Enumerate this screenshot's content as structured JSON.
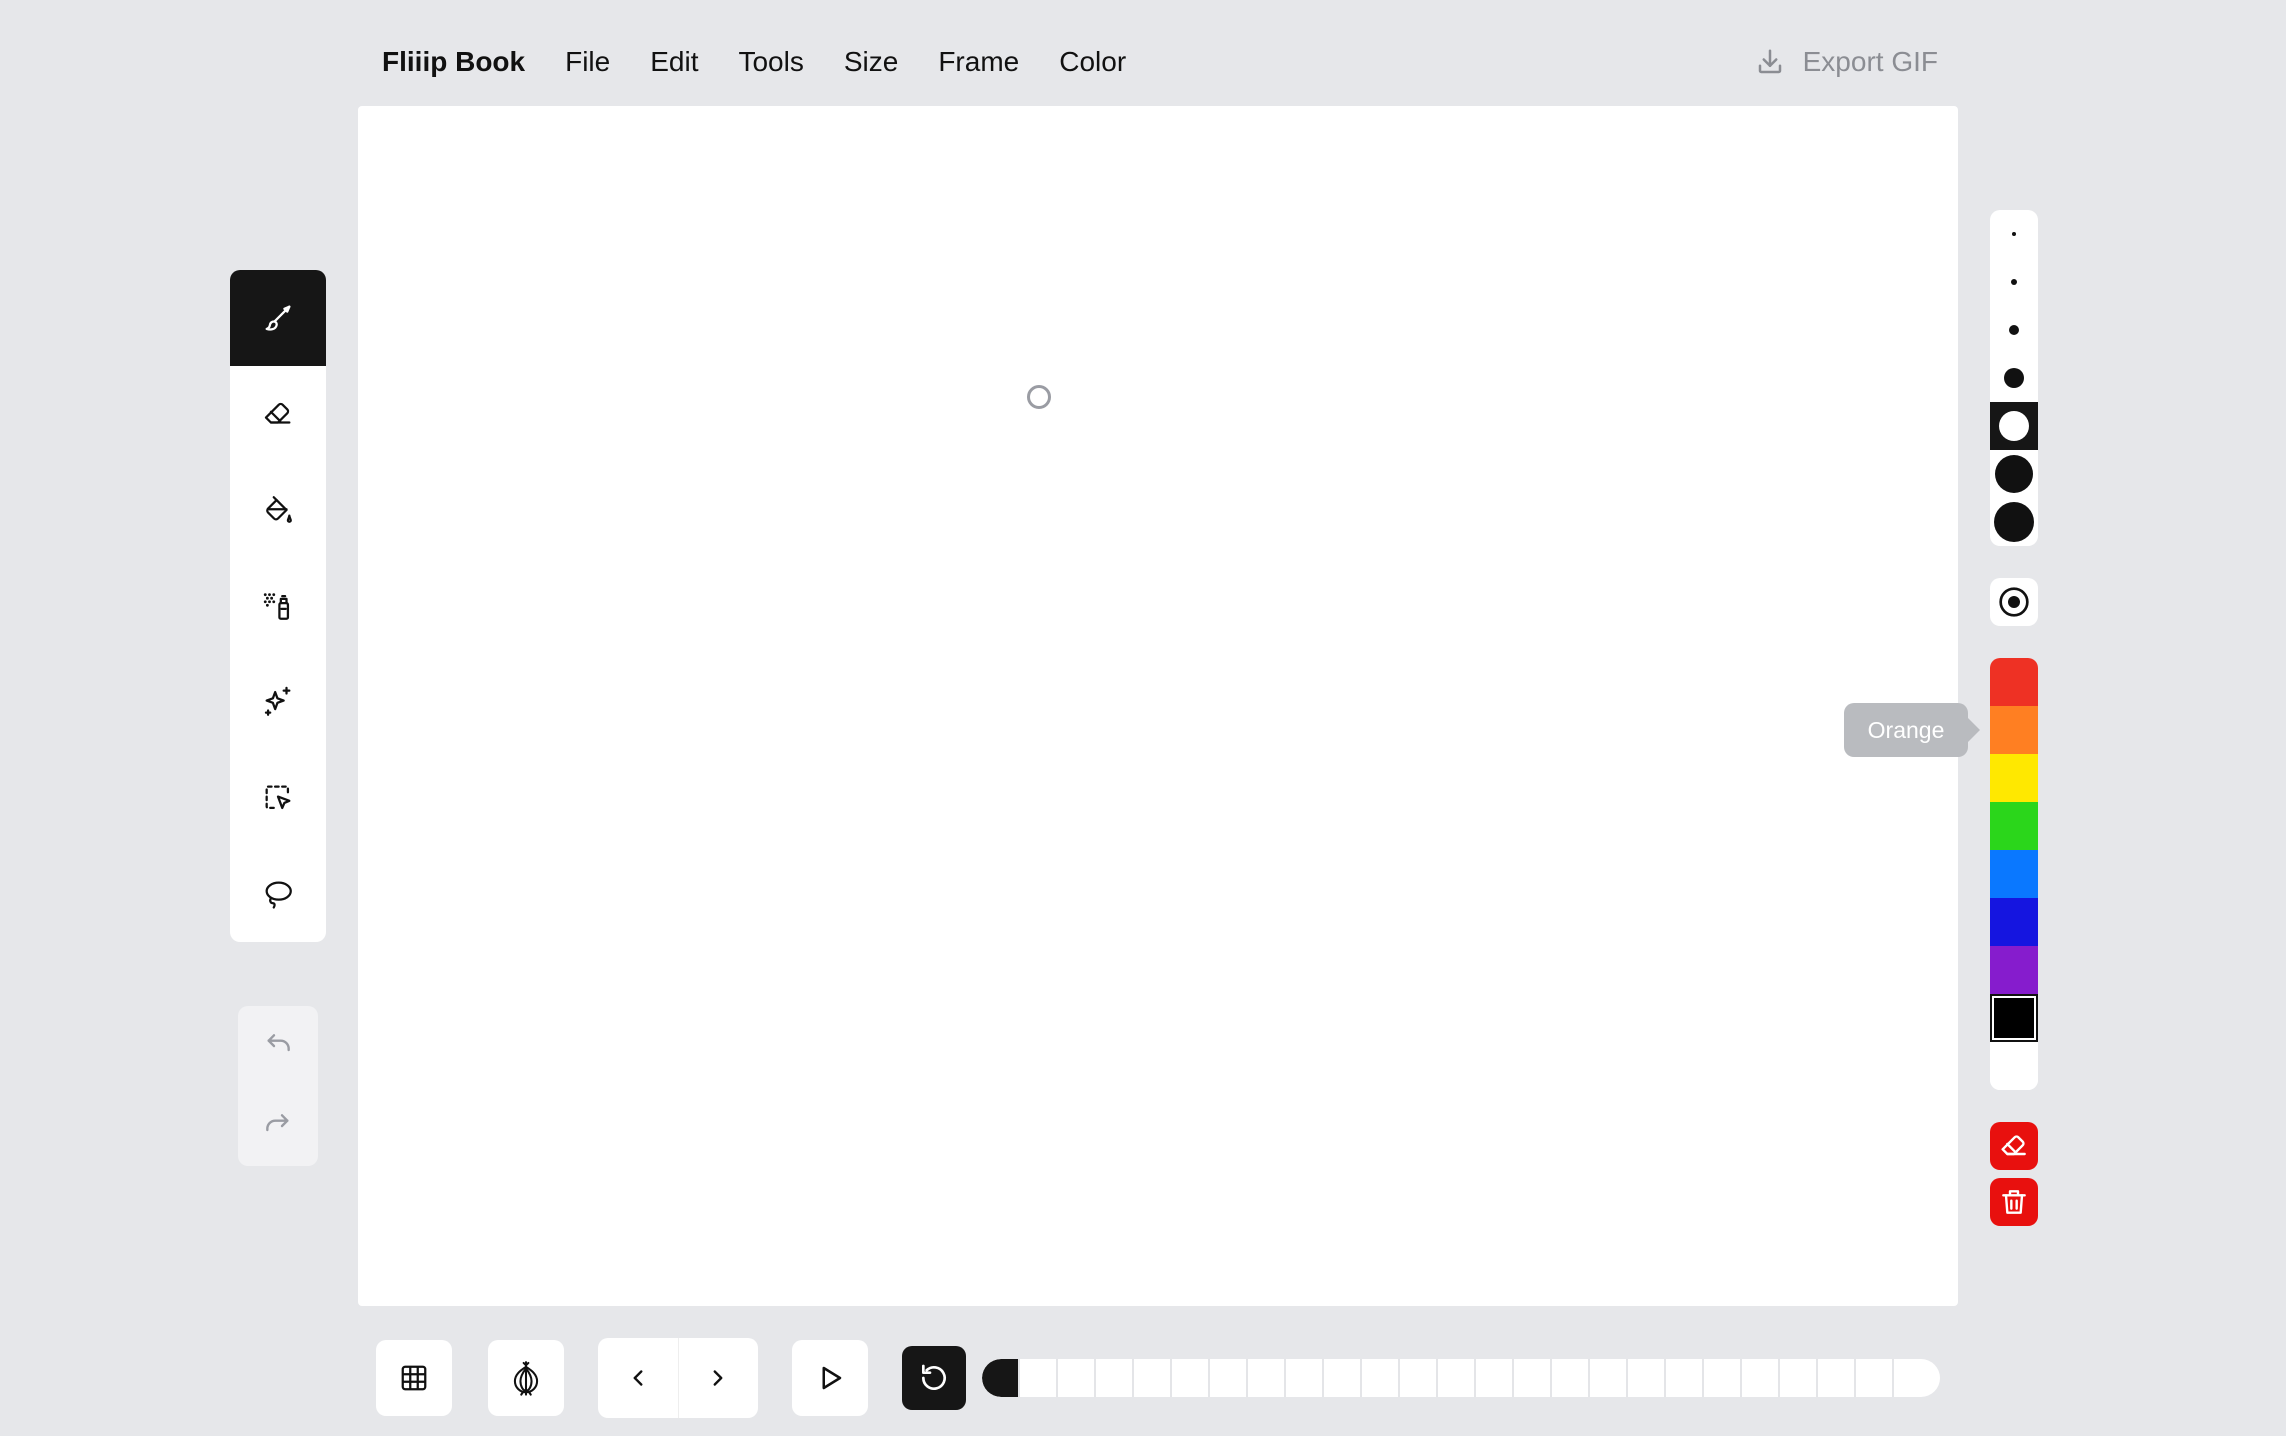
{
  "menubar": {
    "brand": "Fliiip Book",
    "items": [
      "File",
      "Edit",
      "Tools",
      "Size",
      "Frame",
      "Color"
    ],
    "export_label": "Export GIF"
  },
  "tools": [
    {
      "name": "brush-tool",
      "icon": "brush-icon",
      "active": true
    },
    {
      "name": "eraser-tool",
      "icon": "eraser-icon",
      "active": false
    },
    {
      "name": "fill-tool",
      "icon": "paint-bucket-icon",
      "active": false
    },
    {
      "name": "spray-tool",
      "icon": "spray-can-icon",
      "active": false
    },
    {
      "name": "sparkle-tool",
      "icon": "sparkles-icon",
      "active": false
    },
    {
      "name": "select-tool",
      "icon": "select-pointer-icon",
      "active": false
    },
    {
      "name": "lasso-tool",
      "icon": "lasso-icon",
      "active": false
    }
  ],
  "history": [
    {
      "name": "undo-button",
      "icon": "undo-icon"
    },
    {
      "name": "redo-button",
      "icon": "redo-icon"
    }
  ],
  "brush_sizes": {
    "count": 7,
    "selected_index": 4
  },
  "colors": {
    "swatches": [
      {
        "name": "Red",
        "hex": "#ee3124"
      },
      {
        "name": "Orange",
        "hex": "#ff7f22"
      },
      {
        "name": "Yellow",
        "hex": "#ffe800"
      },
      {
        "name": "Green",
        "hex": "#2bd61b"
      },
      {
        "name": "Blue",
        "hex": "#0a78ff"
      },
      {
        "name": "Indigo",
        "hex": "#1515e0"
      },
      {
        "name": "Purple",
        "hex": "#861ccd"
      },
      {
        "name": "Black",
        "hex": "#000000"
      },
      {
        "name": "White",
        "hex": "#ffffff"
      }
    ],
    "selected_index": 7,
    "hover_tooltip": "Orange"
  },
  "danger": {
    "accent": "#e8100e",
    "clear_frame_icon": "eraser-icon",
    "delete_frame_icon": "trash-icon"
  },
  "bottom": {
    "grid_icon": "grid-icon",
    "onion_icon": "onion-skin-icon",
    "prev_icon": "chevron-left-icon",
    "next_icon": "chevron-right-icon",
    "play_icon": "play-icon",
    "loop_icon": "loop-icon",
    "frame_count": 24,
    "current_frame": 1
  }
}
